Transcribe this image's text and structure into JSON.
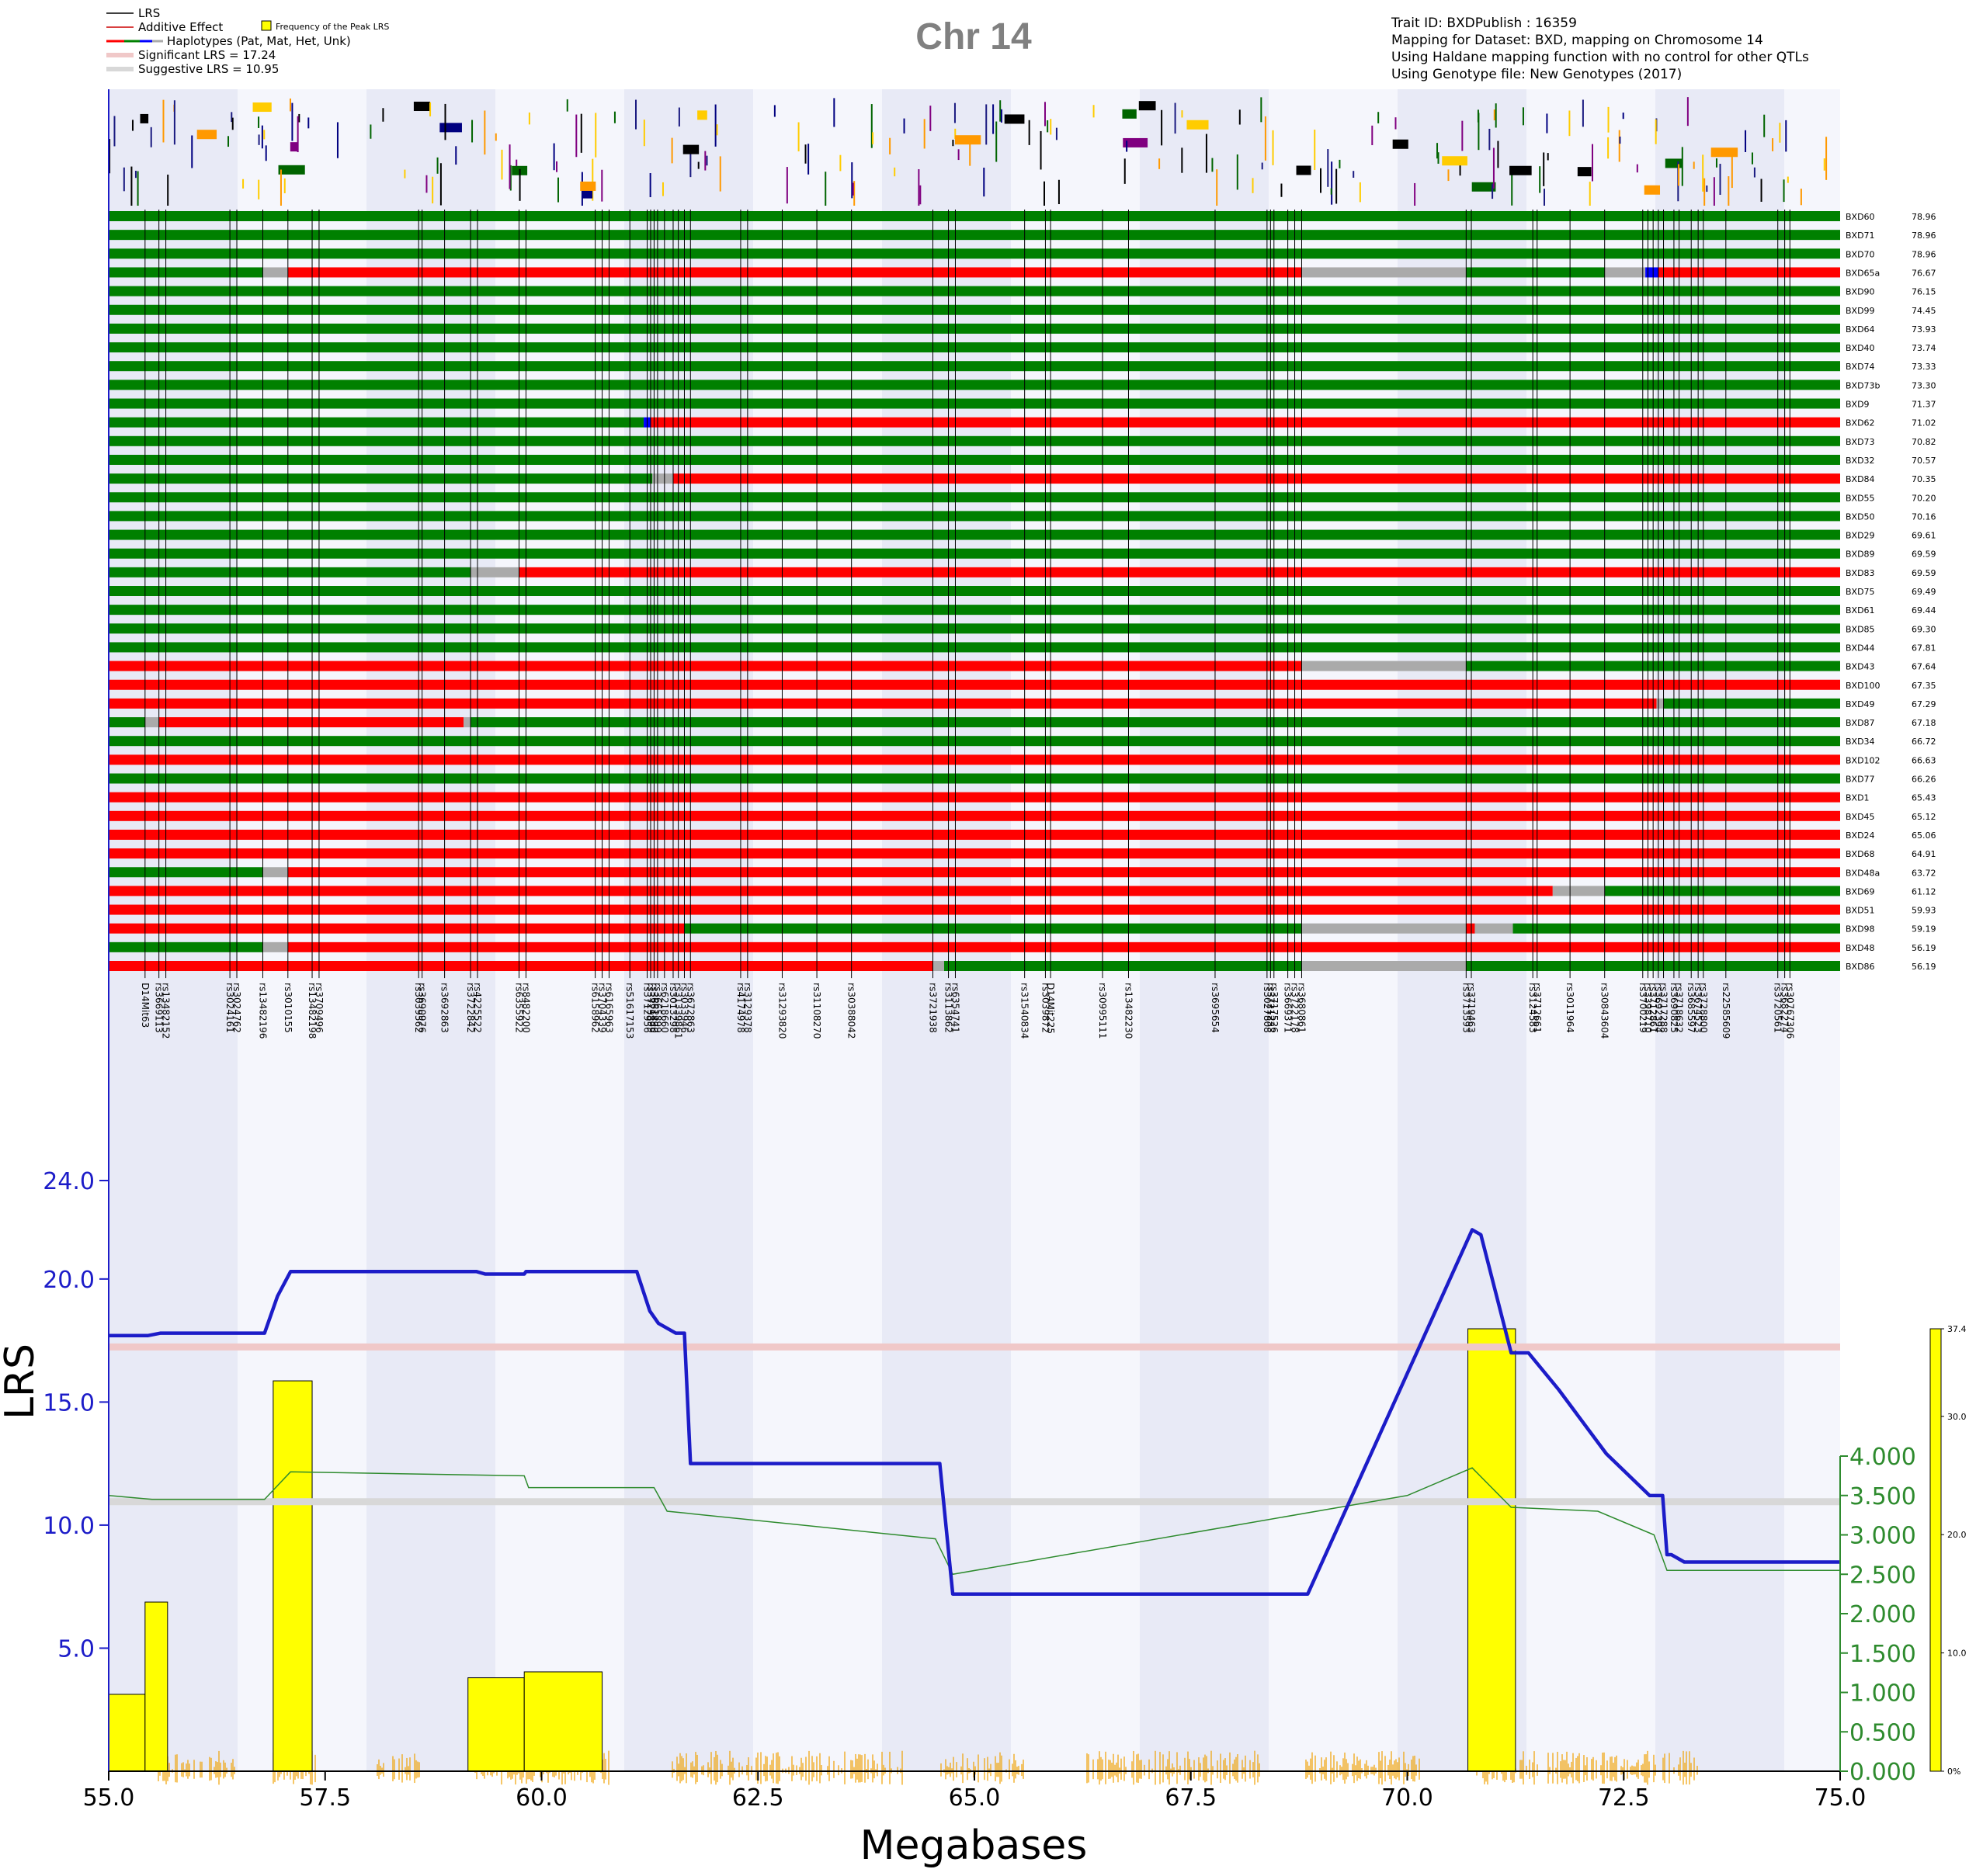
{
  "title": "Chr 14",
  "info_lines": [
    "Trait ID: BXDPublish : 16359",
    "Mapping for Dataset: BXD, mapping on Chromosome 14",
    "Using Haldane mapping function with no control for other QTLs",
    "Using Genotype file: New Genotypes (2017)"
  ],
  "legend": {
    "lrs": "LRS",
    "additive": "Additive Effect",
    "haplotypes": "Haplotypes (Pat, Mat, Het, Unk)",
    "significant": "Significant LRS = 17.24",
    "suggestive": "Suggestive LRS = 10.95",
    "frequency": "Frequency of the Peak LRS"
  },
  "colors": {
    "lrs": "#1c1cc8",
    "additive": "#2e8b2e",
    "pat": "#ff0000",
    "mat": "#008000",
    "het": "#0000ff",
    "unk": "#aaaaaa",
    "significant": "#f0c8c8",
    "suggestive": "#d8d8d8",
    "histogram": "#ffff00",
    "snp_density": "#f0a000",
    "band_dark": "#e8eaf6",
    "band_light": "#f5f6fc"
  },
  "chart_data": {
    "type": "line",
    "title": "Chr 14",
    "xlabel": "Megabases",
    "ylabel": "LRS",
    "xlim": [
      55.0,
      75.0
    ],
    "ylim": [
      0,
      24.0
    ],
    "x_ticks": [
      "55.0",
      "57.5",
      "60.0",
      "62.5",
      "65.0",
      "67.5",
      "70.0",
      "72.5",
      "75.0"
    ],
    "y_ticks": [
      "5.0",
      "10.0",
      "15.0",
      "20.0",
      "24.0"
    ],
    "additive_ticks": [
      "0.000",
      "0.500",
      "1.000",
      "1.500",
      "2.000",
      "2.500",
      "3.000",
      "3.500",
      "4.000"
    ],
    "additive_ylim": [
      0,
      4.0
    ],
    "freq_ticks": [
      "0%",
      "10.0",
      "20.0",
      "30.0",
      "37.4"
    ],
    "freq_ylim": [
      0,
      37.4
    ],
    "significant_lrs": 17.24,
    "suggestive_lrs": 10.95,
    "series": [
      {
        "name": "LRS",
        "x": [
          55.0,
          55.45,
          55.6,
          56.8,
          56.95,
          57.1,
          59.25,
          59.35,
          59.8,
          59.82,
          61.1,
          61.25,
          61.35,
          61.55,
          61.65,
          61.72,
          61.75,
          64.6,
          64.75,
          68.85,
          70.75,
          70.85,
          71.2,
          71.4,
          71.75,
          72.3,
          72.8,
          72.95,
          73.0,
          73.05,
          73.2,
          75.0
        ],
        "values": [
          17.7,
          17.7,
          17.8,
          17.8,
          19.3,
          20.3,
          20.3,
          20.2,
          20.2,
          20.3,
          20.3,
          18.7,
          18.2,
          17.8,
          17.8,
          12.5,
          12.5,
          12.5,
          7.2,
          7.2,
          22.0,
          21.8,
          17.0,
          17.0,
          15.5,
          12.9,
          11.2,
          11.2,
          8.8,
          8.8,
          8.5,
          8.5
        ]
      },
      {
        "name": "Additive Effect",
        "x": [
          55.0,
          55.5,
          56.8,
          57.1,
          59.8,
          59.85,
          61.3,
          61.45,
          64.55,
          64.75,
          70.0,
          70.75,
          71.2,
          72.2,
          72.85,
          73.0,
          75.0
        ],
        "values": [
          3.5,
          3.45,
          3.45,
          3.8,
          3.75,
          3.6,
          3.6,
          3.3,
          2.95,
          2.5,
          3.5,
          3.85,
          3.35,
          3.3,
          3.0,
          2.55,
          2.55
        ]
      }
    ],
    "frequency_bars": [
      {
        "x0": 55.0,
        "x1": 55.42,
        "value": 6.5
      },
      {
        "x0": 55.42,
        "x1": 55.68,
        "value": 14.3
      },
      {
        "x0": 56.9,
        "x1": 57.35,
        "value": 33.0
      },
      {
        "x0": 59.15,
        "x1": 59.8,
        "value": 7.9
      },
      {
        "x0": 59.8,
        "x1": 60.7,
        "value": 8.4
      },
      {
        "x0": 70.7,
        "x1": 71.25,
        "value": 37.4
      }
    ]
  },
  "strains": [
    {
      "name": "BXD60",
      "value": "78.96",
      "segs": [
        [
          55.0,
          75.0,
          "M"
        ]
      ]
    },
    {
      "name": "BXD71",
      "value": "78.96",
      "segs": [
        [
          55.0,
          75.0,
          "M"
        ]
      ]
    },
    {
      "name": "BXD70",
      "value": "78.96",
      "segs": [
        [
          55.0,
          75.0,
          "M"
        ]
      ]
    },
    {
      "name": "BXD65a",
      "value": "76.67",
      "segs": [
        [
          55.0,
          56.78,
          "M"
        ],
        [
          56.78,
          57.07,
          "U"
        ],
        [
          57.07,
          68.78,
          "P"
        ],
        [
          68.78,
          70.68,
          "U"
        ],
        [
          70.68,
          72.28,
          "M"
        ],
        [
          72.28,
          72.75,
          "U"
        ],
        [
          72.75,
          72.9,
          "H"
        ],
        [
          72.9,
          75.0,
          "P"
        ]
      ]
    },
    {
      "name": "BXD90",
      "value": "76.15",
      "segs": [
        [
          55.0,
          75.0,
          "M"
        ]
      ]
    },
    {
      "name": "BXD99",
      "value": "74.45",
      "segs": [
        [
          55.0,
          75.0,
          "M"
        ]
      ]
    },
    {
      "name": "BXD64",
      "value": "73.93",
      "segs": [
        [
          55.0,
          75.0,
          "M"
        ]
      ]
    },
    {
      "name": "BXD40",
      "value": "73.74",
      "segs": [
        [
          55.0,
          75.0,
          "M"
        ]
      ]
    },
    {
      "name": "BXD74",
      "value": "73.33",
      "segs": [
        [
          55.0,
          75.0,
          "M"
        ]
      ]
    },
    {
      "name": "BXD73b",
      "value": "73.30",
      "segs": [
        [
          55.0,
          75.0,
          "M"
        ]
      ]
    },
    {
      "name": "BXD9",
      "value": "71.37",
      "segs": [
        [
          55.0,
          75.0,
          "M"
        ]
      ]
    },
    {
      "name": "BXD62",
      "value": "71.02",
      "segs": [
        [
          55.0,
          61.18,
          "M"
        ],
        [
          61.18,
          61.26,
          "H"
        ],
        [
          61.26,
          75.0,
          "P"
        ]
      ]
    },
    {
      "name": "BXD73",
      "value": "70.82",
      "segs": [
        [
          55.0,
          75.0,
          "M"
        ]
      ]
    },
    {
      "name": "BXD32",
      "value": "70.57",
      "segs": [
        [
          55.0,
          75.0,
          "M"
        ]
      ]
    },
    {
      "name": "BXD84",
      "value": "70.35",
      "segs": [
        [
          55.0,
          61.28,
          "M"
        ],
        [
          61.28,
          61.52,
          "U"
        ],
        [
          61.52,
          75.0,
          "P"
        ]
      ]
    },
    {
      "name": "BXD55",
      "value": "70.20",
      "segs": [
        [
          55.0,
          75.0,
          "M"
        ]
      ]
    },
    {
      "name": "BXD50",
      "value": "70.16",
      "segs": [
        [
          55.0,
          75.0,
          "M"
        ]
      ]
    },
    {
      "name": "BXD29",
      "value": "69.61",
      "segs": [
        [
          55.0,
          75.0,
          "M"
        ]
      ]
    },
    {
      "name": "BXD89",
      "value": "69.59",
      "segs": [
        [
          55.0,
          75.0,
          "M"
        ]
      ]
    },
    {
      "name": "BXD83",
      "value": "69.59",
      "segs": [
        [
          55.0,
          59.18,
          "M"
        ],
        [
          59.18,
          59.74,
          "U"
        ],
        [
          59.74,
          75.0,
          "P"
        ]
      ]
    },
    {
      "name": "BXD75",
      "value": "69.49",
      "segs": [
        [
          55.0,
          75.0,
          "M"
        ]
      ]
    },
    {
      "name": "BXD61",
      "value": "69.44",
      "segs": [
        [
          55.0,
          75.0,
          "M"
        ]
      ]
    },
    {
      "name": "BXD85",
      "value": "69.30",
      "segs": [
        [
          55.0,
          75.0,
          "M"
        ]
      ]
    },
    {
      "name": "BXD44",
      "value": "67.81",
      "segs": [
        [
          55.0,
          75.0,
          "M"
        ]
      ]
    },
    {
      "name": "BXD43",
      "value": "67.64",
      "segs": [
        [
          55.0,
          68.78,
          "P"
        ],
        [
          68.78,
          70.68,
          "U"
        ],
        [
          70.68,
          75.0,
          "M"
        ]
      ]
    },
    {
      "name": "BXD100",
      "value": "67.35",
      "segs": [
        [
          55.0,
          75.0,
          "P"
        ]
      ]
    },
    {
      "name": "BXD49",
      "value": "67.29",
      "segs": [
        [
          55.0,
          72.88,
          "P"
        ],
        [
          72.88,
          72.96,
          "U"
        ],
        [
          72.96,
          75.0,
          "M"
        ]
      ]
    },
    {
      "name": "BXD87",
      "value": "67.18",
      "segs": [
        [
          55.0,
          55.42,
          "M"
        ],
        [
          55.42,
          55.58,
          "U"
        ],
        [
          55.58,
          59.1,
          "P"
        ],
        [
          59.1,
          59.18,
          "U"
        ],
        [
          59.18,
          75.0,
          "M"
        ]
      ]
    },
    {
      "name": "BXD34",
      "value": "66.72",
      "segs": [
        [
          55.0,
          75.0,
          "M"
        ]
      ]
    },
    {
      "name": "BXD102",
      "value": "66.63",
      "segs": [
        [
          55.0,
          75.0,
          "P"
        ]
      ]
    },
    {
      "name": "BXD77",
      "value": "66.26",
      "segs": [
        [
          55.0,
          75.0,
          "M"
        ]
      ]
    },
    {
      "name": "BXD1",
      "value": "65.43",
      "segs": [
        [
          55.0,
          75.0,
          "P"
        ]
      ]
    },
    {
      "name": "BXD45",
      "value": "65.12",
      "segs": [
        [
          55.0,
          75.0,
          "P"
        ]
      ]
    },
    {
      "name": "BXD24",
      "value": "65.06",
      "segs": [
        [
          55.0,
          75.0,
          "P"
        ]
      ]
    },
    {
      "name": "BXD68",
      "value": "64.91",
      "segs": [
        [
          55.0,
          75.0,
          "P"
        ]
      ]
    },
    {
      "name": "BXD48a",
      "value": "63.72",
      "segs": [
        [
          55.0,
          56.78,
          "M"
        ],
        [
          56.78,
          57.07,
          "U"
        ],
        [
          57.07,
          75.0,
          "P"
        ]
      ]
    },
    {
      "name": "BXD69",
      "value": "61.12",
      "segs": [
        [
          55.0,
          71.68,
          "P"
        ],
        [
          71.68,
          72.28,
          "U"
        ],
        [
          72.28,
          75.0,
          "M"
        ]
      ]
    },
    {
      "name": "BXD51",
      "value": "59.93",
      "segs": [
        [
          55.0,
          75.0,
          "P"
        ]
      ]
    },
    {
      "name": "BXD98",
      "value": "59.19",
      "segs": [
        [
          55.0,
          61.65,
          "P"
        ],
        [
          61.65,
          68.78,
          "M"
        ],
        [
          68.78,
          70.68,
          "U"
        ],
        [
          70.68,
          70.78,
          "P"
        ],
        [
          70.78,
          71.22,
          "U"
        ],
        [
          71.22,
          75.0,
          "M"
        ]
      ]
    },
    {
      "name": "BXD48",
      "value": "56.19",
      "segs": [
        [
          55.0,
          56.78,
          "M"
        ],
        [
          56.78,
          57.07,
          "U"
        ],
        [
          57.07,
          75.0,
          "P"
        ]
      ]
    },
    {
      "name": "BXD86",
      "value": "56.19",
      "segs": [
        [
          55.0,
          64.52,
          "P"
        ],
        [
          64.52,
          64.65,
          "U"
        ],
        [
          64.65,
          68.78,
          "M"
        ],
        [
          68.78,
          70.68,
          "U"
        ],
        [
          70.68,
          75.0,
          "M"
        ]
      ]
    }
  ],
  "markers": [
    {
      "name": "D14Mit63",
      "mb": 55.42
    },
    {
      "name": "rs3669113",
      "mb": 55.58
    },
    {
      "name": "rs13482152",
      "mb": 55.66
    },
    {
      "name": "rs3024161",
      "mb": 56.4
    },
    {
      "name": "rs3024762",
      "mb": 56.48
    },
    {
      "name": "rs13482196",
      "mb": 56.78
    },
    {
      "name": "rs3010155",
      "mb": 57.07
    },
    {
      "name": "rs13482198",
      "mb": 57.35
    },
    {
      "name": "rs3709496",
      "mb": 57.43
    },
    {
      "name": "rs3039562",
      "mb": 58.58
    },
    {
      "name": "rs3690976",
      "mb": 58.62
    },
    {
      "name": "rs3692863",
      "mb": 58.88
    },
    {
      "name": "rs3722842",
      "mb": 59.18
    },
    {
      "name": "rs4225522",
      "mb": 59.26
    },
    {
      "name": "rs6355922",
      "mb": 59.74
    },
    {
      "name": "rs8482200",
      "mb": 59.82
    },
    {
      "name": "rs6158962",
      "mb": 60.62
    },
    {
      "name": "rs3704339",
      "mb": 60.7
    },
    {
      "name": "rs6165963",
      "mb": 60.78
    },
    {
      "name": "rs51617153",
      "mb": 61.02
    },
    {
      "name": "rs3712956",
      "mb": 61.22
    },
    {
      "name": "rs3729899",
      "mb": 61.26
    },
    {
      "name": "rs3661490",
      "mb": 61.3
    },
    {
      "name": "rs3665899",
      "mb": 61.34
    },
    {
      "name": "rs6218660",
      "mb": 61.42
    },
    {
      "name": "rs3013298",
      "mb": 61.52
    },
    {
      "name": "rs31339861",
      "mb": 61.58
    },
    {
      "name": "rs3033946",
      "mb": 61.65
    },
    {
      "name": "rs3672863",
      "mb": 61.72
    },
    {
      "name": "rs4174978",
      "mb": 62.3
    },
    {
      "name": "rs3129378",
      "mb": 62.38
    },
    {
      "name": "rs31293820",
      "mb": 62.78
    },
    {
      "name": "rs31108270",
      "mb": 63.18
    },
    {
      "name": "rs30388042",
      "mb": 63.58
    },
    {
      "name": "rs3721938",
      "mb": 64.52
    },
    {
      "name": "rs3113862",
      "mb": 64.7
    },
    {
      "name": "rs6354741",
      "mb": 64.78
    },
    {
      "name": "rs31540834",
      "mb": 65.58
    },
    {
      "name": "rs3039872",
      "mb": 65.82
    },
    {
      "name": "D14Mit225",
      "mb": 65.88
    },
    {
      "name": "rs30995111",
      "mb": 66.48
    },
    {
      "name": "rs13482230",
      "mb": 66.78
    },
    {
      "name": "rs3695654",
      "mb": 67.78
    },
    {
      "name": "rs3027808",
      "mb": 68.38
    },
    {
      "name": "rs3721233",
      "mb": 68.42
    },
    {
      "name": "rs3717526",
      "mb": 68.46
    },
    {
      "name": "rs3669371",
      "mb": 68.62
    },
    {
      "name": "rs3722178",
      "mb": 68.7
    },
    {
      "name": "rs3680861",
      "mb": 68.78
    },
    {
      "name": "rs3713593",
      "mb": 70.68
    },
    {
      "name": "rs3719463",
      "mb": 70.74
    },
    {
      "name": "rs3124583",
      "mb": 71.45
    },
    {
      "name": "rs3712661",
      "mb": 71.5
    },
    {
      "name": "rs3011964",
      "mb": 71.88
    },
    {
      "name": "rs30843604",
      "mb": 72.28
    },
    {
      "name": "rs3700219",
      "mb": 72.72
    },
    {
      "name": "rs3398710",
      "mb": 72.78
    },
    {
      "name": "rs3712861",
      "mb": 72.84
    },
    {
      "name": "rs3692394",
      "mb": 72.9
    },
    {
      "name": "rs3717288",
      "mb": 72.96
    },
    {
      "name": "rs3690825",
      "mb": 73.08
    },
    {
      "name": "rs3718632",
      "mb": 73.14
    },
    {
      "name": "rs3685597",
      "mb": 73.28
    },
    {
      "name": "rs3674523",
      "mb": 73.36
    },
    {
      "name": "rs3728800",
      "mb": 73.42
    },
    {
      "name": "rs22585609",
      "mb": 73.68
    },
    {
      "name": "rs3720561",
      "mb": 74.28
    },
    {
      "name": "rs3682274",
      "mb": 74.36
    },
    {
      "name": "rs30767306",
      "mb": 74.42
    }
  ]
}
